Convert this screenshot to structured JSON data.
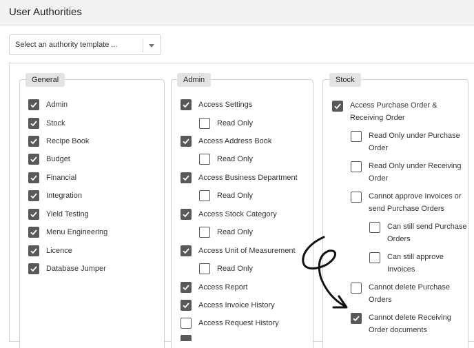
{
  "page": {
    "title": "User Authorities"
  },
  "template_select": {
    "placeholder": "Select an authority template ..."
  },
  "groups": {
    "general": {
      "legend": "General",
      "items": [
        {
          "label": "Admin",
          "checked": true
        },
        {
          "label": "Stock",
          "checked": true
        },
        {
          "label": "Recipe Book",
          "checked": true
        },
        {
          "label": "Budget",
          "checked": true
        },
        {
          "label": "Financial",
          "checked": true
        },
        {
          "label": "Integration",
          "checked": true
        },
        {
          "label": "Yield Testing",
          "checked": true
        },
        {
          "label": "Menu Engineering",
          "checked": true
        },
        {
          "label": "Licence",
          "checked": true
        },
        {
          "label": "Database Jumper",
          "checked": true
        }
      ]
    },
    "admin": {
      "legend": "Admin",
      "items": [
        {
          "label": "Access Settings",
          "checked": true
        },
        {
          "label": "Read Only",
          "checked": false
        },
        {
          "label": "Access Address Book",
          "checked": true
        },
        {
          "label": "Read Only",
          "checked": false
        },
        {
          "label": "Access Business Department",
          "checked": true
        },
        {
          "label": "Read Only",
          "checked": false
        },
        {
          "label": "Access Stock Category",
          "checked": true
        },
        {
          "label": "Read Only",
          "checked": false
        },
        {
          "label": "Access Unit of Measurement",
          "checked": true
        },
        {
          "label": "Read Only",
          "checked": false
        },
        {
          "label": "Access Report",
          "checked": true
        },
        {
          "label": "Access Invoice History",
          "checked": true
        },
        {
          "label": "Access Request History",
          "checked": false
        }
      ]
    },
    "stock": {
      "legend": "Stock",
      "items": [
        {
          "label": "Access Purchase Order & Receiving Order",
          "checked": true
        },
        {
          "label": "Read Only under Purchase Order",
          "checked": false
        },
        {
          "label": "Read Only under Receiving Order",
          "checked": false
        },
        {
          "label": "Cannot approve Invoices or send Purchase Orders",
          "checked": false
        },
        {
          "label": "Can still send Purchase Orders",
          "checked": false
        },
        {
          "label": "Can still approve Invoices",
          "checked": false
        },
        {
          "label": "Cannot delete Purchase Orders",
          "checked": false
        },
        {
          "label": "Cannot delete Receiving Order documents",
          "checked": true
        }
      ]
    }
  },
  "icons": {
    "checkmark": "check-icon",
    "dropdown": "chevron-down-icon",
    "annotation": "curved-arrow-icon"
  },
  "colors": {
    "checkbox_fill": "#595959",
    "legend_bg": "#e3e3e3",
    "topbar_bg": "#f3f3f3"
  }
}
